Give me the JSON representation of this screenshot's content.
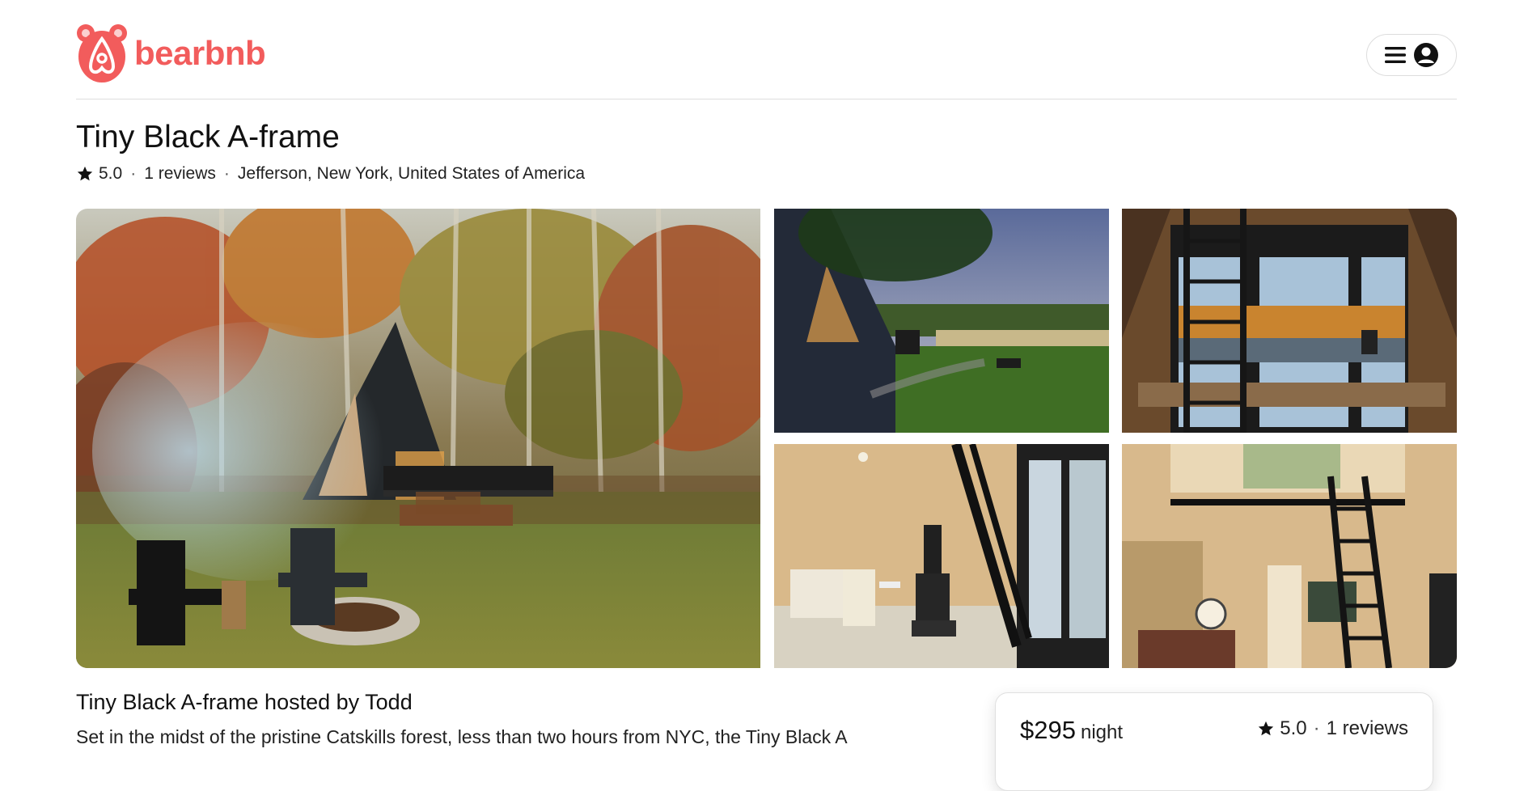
{
  "brand": {
    "name": "bearbnb",
    "color": "#f25c5c",
    "logo_icon": "bear-airbnb-logo-icon"
  },
  "header": {
    "menu_icon": "hamburger-menu-icon",
    "account_icon": "user-circle-icon"
  },
  "listing": {
    "title": "Tiny Black A-frame",
    "rating": "5.0",
    "reviews": "1 reviews",
    "location": "Jefferson, New York, United States of America",
    "separator": "·"
  },
  "gallery": [
    {
      "name": "forest-cabin-exterior-photo"
    },
    {
      "name": "cabin-lake-view-photo"
    },
    {
      "name": "glass-doors-deck-photo"
    },
    {
      "name": "interior-kitchen-stove-photo"
    },
    {
      "name": "loft-ladder-photo"
    }
  ],
  "host": {
    "heading": "Tiny Black A-frame hosted by Todd",
    "description": "Set in the midst of the pristine Catskills forest, less than two hours from NYC, the Tiny Black A"
  },
  "booking": {
    "price": "$295",
    "unit": "night",
    "rating": "5.0",
    "reviews": "1 reviews",
    "separator": "·"
  }
}
